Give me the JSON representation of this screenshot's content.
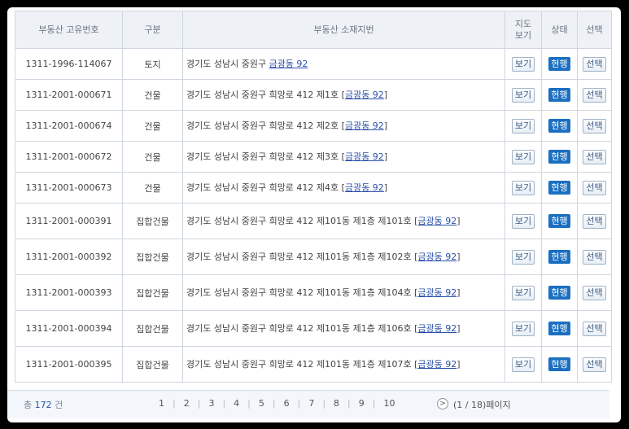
{
  "headers": {
    "id": "부동산 고유번호",
    "type": "구분",
    "addr": "부동산 소재지번",
    "map": "지도 보기",
    "status": "상태",
    "select": "선택"
  },
  "rows": [
    {
      "id": "1311-1996-114067",
      "type": "토지",
      "addr": "경기도 성남시 중원구 ",
      "link": "금광동 92",
      "open": "",
      "close": "",
      "view": "보기",
      "status": "현행",
      "sel": "선택"
    },
    {
      "id": "1311-2001-000671",
      "type": "건물",
      "addr": "경기도 성남시 중원구 희망로 412 제1호 ",
      "link": "금광동 92",
      "open": "[",
      "close": "]",
      "view": "보기",
      "status": "현행",
      "sel": "선택"
    },
    {
      "id": "1311-2001-000674",
      "type": "건물",
      "addr": "경기도 성남시 중원구 희망로 412 제2호 ",
      "link": "금광동 92",
      "open": "[",
      "close": "]",
      "view": "보기",
      "status": "현행",
      "sel": "선택"
    },
    {
      "id": "1311-2001-000672",
      "type": "건물",
      "addr": "경기도 성남시 중원구 희망로 412 제3호 ",
      "link": "금광동 92",
      "open": "[",
      "close": "]",
      "view": "보기",
      "status": "현행",
      "sel": "선택"
    },
    {
      "id": "1311-2001-000673",
      "type": "건물",
      "addr": "경기도 성남시 중원구 희망로 412 제4호 ",
      "link": "금광동 92",
      "open": "[",
      "close": "]",
      "view": "보기",
      "status": "현행",
      "sel": "선택"
    },
    {
      "id": "1311-2001-000391",
      "type": "집합건물",
      "addr": "경기도 성남시 중원구 희망로 412 제101동 제1층 제101호 ",
      "link": "금광동 92",
      "open": "[",
      "close": "]",
      "view": "보기",
      "status": "현행",
      "sel": "선택"
    },
    {
      "id": "1311-2001-000392",
      "type": "집합건물",
      "addr": "경기도 성남시 중원구 희망로 412 제101동 제1층 제102호 ",
      "link": "금광동 92",
      "open": "[",
      "close": "]",
      "view": "보기",
      "status": "현행",
      "sel": "선택"
    },
    {
      "id": "1311-2001-000393",
      "type": "집합건물",
      "addr": "경기도 성남시 중원구 희망로 412 제101동 제1층 제104호 ",
      "link": "금광동 92",
      "open": "[",
      "close": "]",
      "view": "보기",
      "status": "현행",
      "sel": "선택"
    },
    {
      "id": "1311-2001-000394",
      "type": "집합건물",
      "addr": "경기도 성남시 중원구 희망로 412 제101동 제1층 제106호 ",
      "link": "금광동 92",
      "open": "[",
      "close": "]",
      "view": "보기",
      "status": "현행",
      "sel": "선택"
    },
    {
      "id": "1311-2001-000395",
      "type": "집합건물",
      "addr": "경기도 성남시 중원구 희망로 412 제101동 제1층 제107호 ",
      "link": "금광동 92",
      "open": "[",
      "close": "]",
      "view": "보기",
      "status": "현행",
      "sel": "선택"
    }
  ],
  "pager": {
    "total_prefix": "총 ",
    "total_count": "172",
    "total_suffix": " 건",
    "pages": [
      "1",
      "2",
      "3",
      "4",
      "5",
      "6",
      "7",
      "8",
      "9",
      "10"
    ],
    "next_label": ">",
    "page_info": "(1 / 18)페이지"
  },
  "colors": {
    "status_badge": "#1b6fc1",
    "link": "#2a4fa8",
    "header_bg": "#eef2f7"
  }
}
